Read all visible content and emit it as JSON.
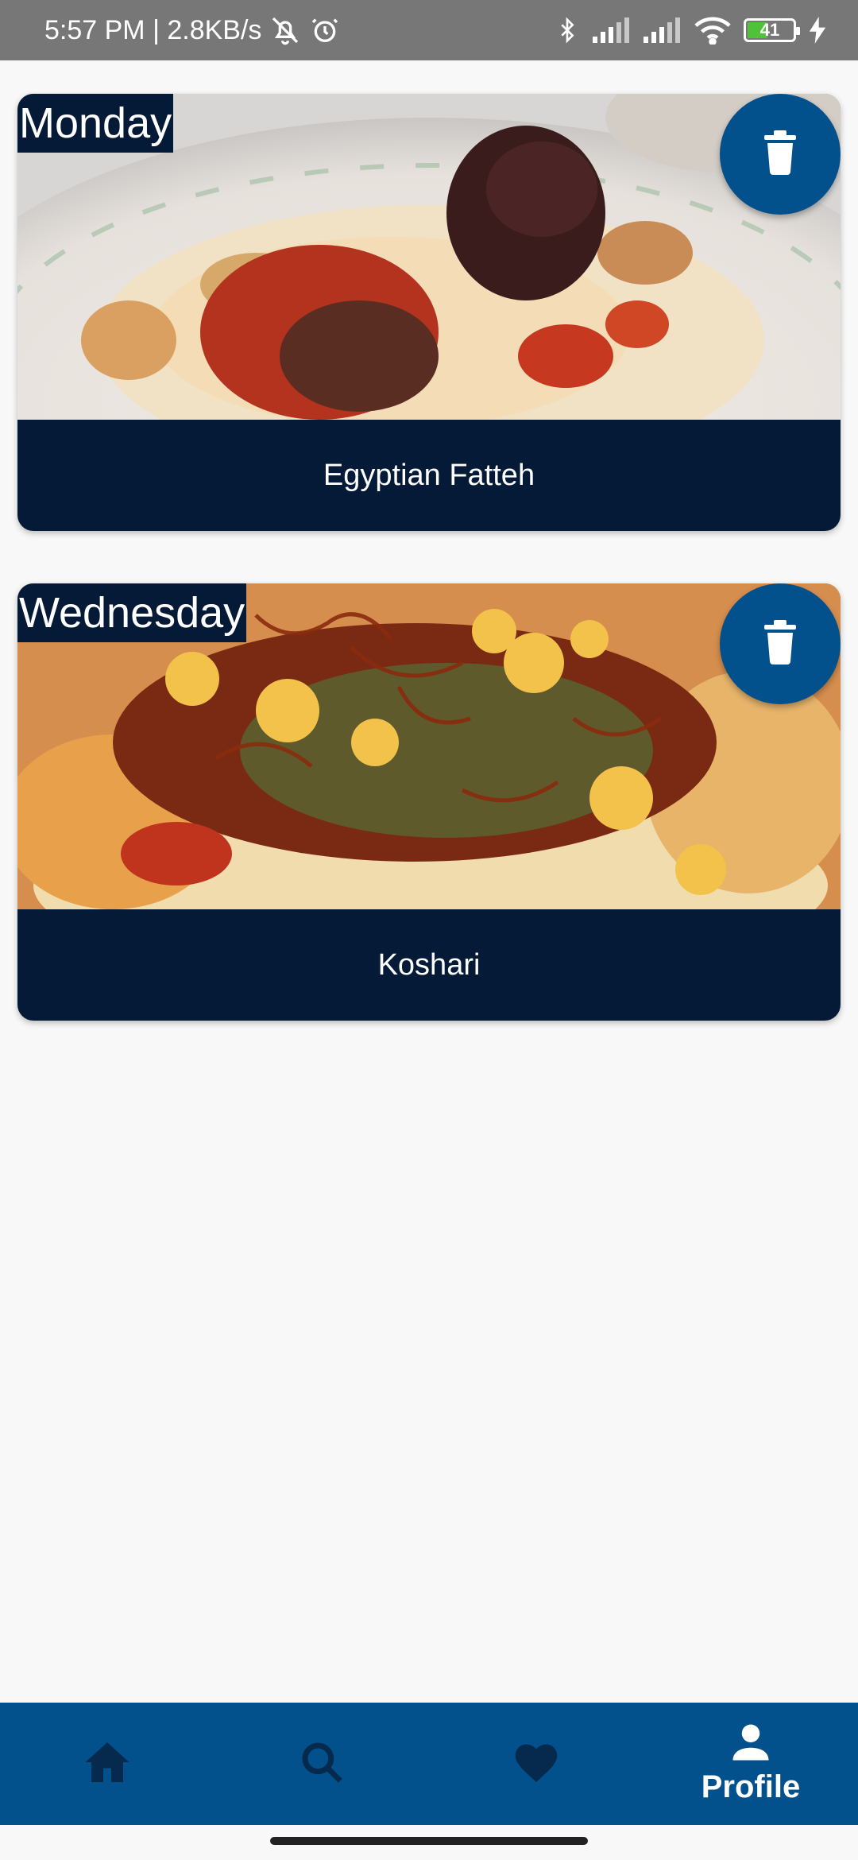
{
  "status_bar": {
    "time_text": "5:57 PM | 2.8KB/s",
    "battery_level": "41"
  },
  "meals": [
    {
      "day": "Monday",
      "name": "Egyptian Fatteh"
    },
    {
      "day": "Wednesday",
      "name": "Koshari"
    }
  ],
  "bottom_nav": {
    "items": [
      {
        "icon": "home-icon",
        "label": ""
      },
      {
        "icon": "search-icon",
        "label": ""
      },
      {
        "icon": "heart-icon",
        "label": ""
      },
      {
        "icon": "person-icon",
        "label": "Profile"
      }
    ],
    "active_index": 3
  },
  "colors": {
    "primary": "#03518c",
    "card_dark": "#041a36",
    "background": "#f8f8f8",
    "nav_inactive_icon": "#062a4d"
  }
}
